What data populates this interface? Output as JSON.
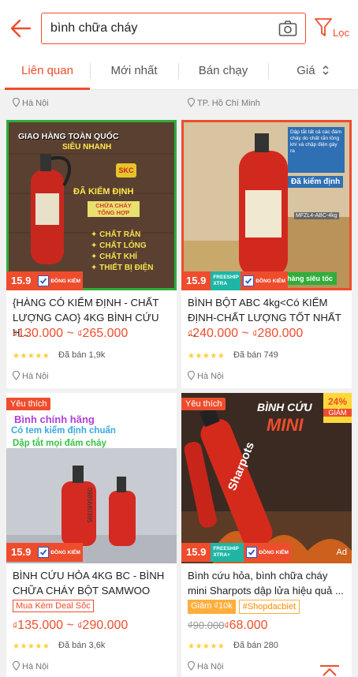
{
  "search": {
    "query": "bình chữa cháy",
    "filter_label": "Lọc"
  },
  "tabs": [
    {
      "label": "Liên quan"
    },
    {
      "label": "Mới nhất"
    },
    {
      "label": "Bán chạy"
    },
    {
      "label": "Giá"
    }
  ],
  "top_locations": [
    "Hà Nội",
    "TP. Hồ Chí Minh"
  ],
  "products": [
    {
      "title": "{HÀNG CÓ KIỂM ĐỊNH - CHẤT LƯỢNG CAO} 4KG BÌNH CỨU H...",
      "price_from": "130.000",
      "price_to": "265.000",
      "sold": "Đã bán 1,9k",
      "location": "Hà Nội",
      "badge_number": "15.9",
      "badge_check": "ĐỒNG KIỂM",
      "image_text": {
        "line1": "GIAO HÀNG TOÀN QUỐC",
        "line2": "SIÊU NHANH",
        "line3": "ĐÃ KIỂM ĐỊNH",
        "line4": "CHỮA CHÁY TỔNG HỢP",
        "line5": "CHẤT RẮN",
        "line6": "CHẤT LỎNG",
        "line7": "CHẤT KHÍ",
        "line8": "THIẾT BỊ ĐIỆN",
        "seal": "SKC"
      }
    },
    {
      "title": "BÌNH BỘT ABC 4kg<Có KIỂM ĐỊNH-CHẤT LƯỢNG TỐT NHẤT ...",
      "price_from": "240.000",
      "price_to": "280.000",
      "sold": "Đã bán 749",
      "location": "Hà Nội",
      "badge_number": "15.9",
      "badge_ship": "FREESHIP XTRA",
      "badge_check": "ĐỒNG KIỂM",
      "image_text": {
        "note": "Dập tắt tất cả các đám cháy do chất rắn lỏng khí và chập điện gây ra",
        "verified": "Đã kiểm định",
        "model": "MFZL4-ABC-4kg",
        "footer": "hàng siêu tốc"
      }
    },
    {
      "title": "BÌNH CỨU HỎA 4KG BC - BÌNH CHỮA CHÁY BỘT SAMWOO",
      "tag": "Mua Kèm Deal Sốc",
      "price_from": "135.000",
      "price_to": "290.000",
      "sold": "Đã bán 3,6k",
      "location": "Hà Nội",
      "favorite": "Yêu thích",
      "badge_number": "15.9",
      "badge_check": "ĐỒNG KIỂM",
      "image_text": {
        "line1": "Bình chính hãng",
        "line2": "Có tem kiểm định chuẩn",
        "line3": "Dập tắt mọi đám cháy",
        "phone": "0985680395"
      }
    },
    {
      "title": "Bình cứu hỏa, bình chữa cháy mini Sharpots dập lửa hiệu quả ...",
      "tags": [
        "Giảm ₫10k",
        "#Shopdacbiet"
      ],
      "old_price": "₫90.000",
      "price": "68.000",
      "sold": "Đã bán 280",
      "location": "Hà Nội",
      "favorite": "Yêu thích",
      "badge_number": "15.9",
      "badge_ship": "FREESHIP XTRA+",
      "badge_check": "ĐỒNG KIỂM",
      "ad": "Ad",
      "discount": "24%",
      "discount_label": "GIẢM",
      "image_text": {
        "headline": "BÌNH CỨU",
        "headline2": "MINI",
        "brand": "Sharpots"
      }
    }
  ],
  "colors": {
    "accent": "#ee4d2d",
    "star": "#ffce3d"
  }
}
